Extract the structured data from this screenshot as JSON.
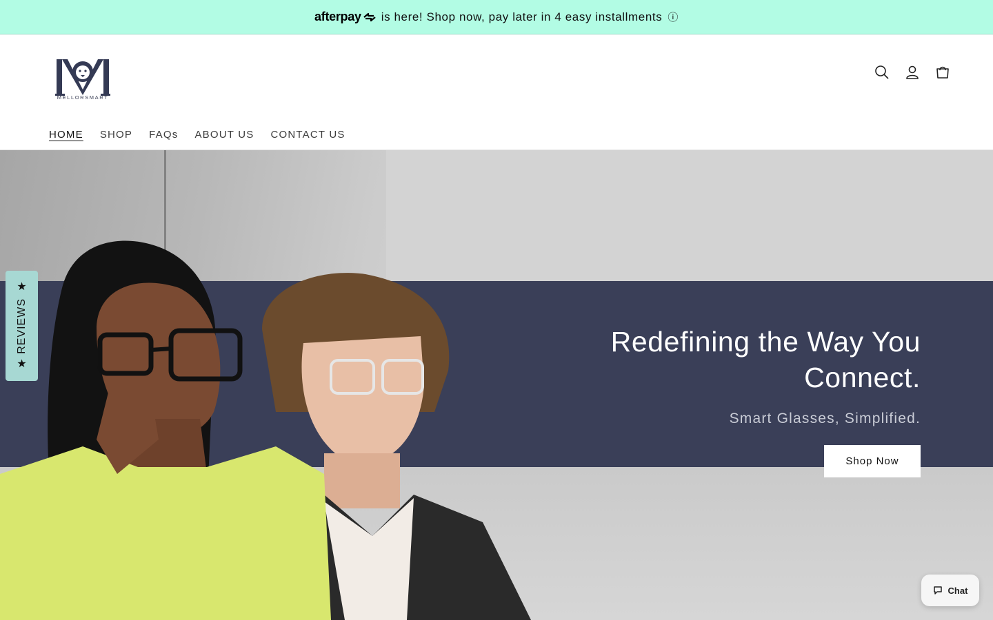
{
  "announcement": {
    "brand": "afterpay",
    "text": "is here! Shop now, pay later in 4 easy installments",
    "info_glyph": "ⓘ",
    "background": "#b2fce4"
  },
  "logo": {
    "wordmark": "MELLORSMART",
    "color": "#343a54"
  },
  "header_icons": [
    "search-icon",
    "account-icon",
    "cart-icon"
  ],
  "nav": {
    "items": [
      {
        "label": "HOME",
        "active": true
      },
      {
        "label": "SHOP",
        "active": false
      },
      {
        "label": "FAQs",
        "active": false
      },
      {
        "label": "ABOUT US",
        "active": false
      },
      {
        "label": "CONTACT US",
        "active": false
      }
    ]
  },
  "hero": {
    "title": "Redefining the Way You Connect.",
    "subtitle": "Smart Glasses, Simplified.",
    "button_label": "Shop Now",
    "band_color": "#3a3f58"
  },
  "reviews_tab": {
    "label": "REVIEWS",
    "star": "★",
    "color": "#a7d8d3"
  },
  "chat": {
    "label": "Chat"
  }
}
